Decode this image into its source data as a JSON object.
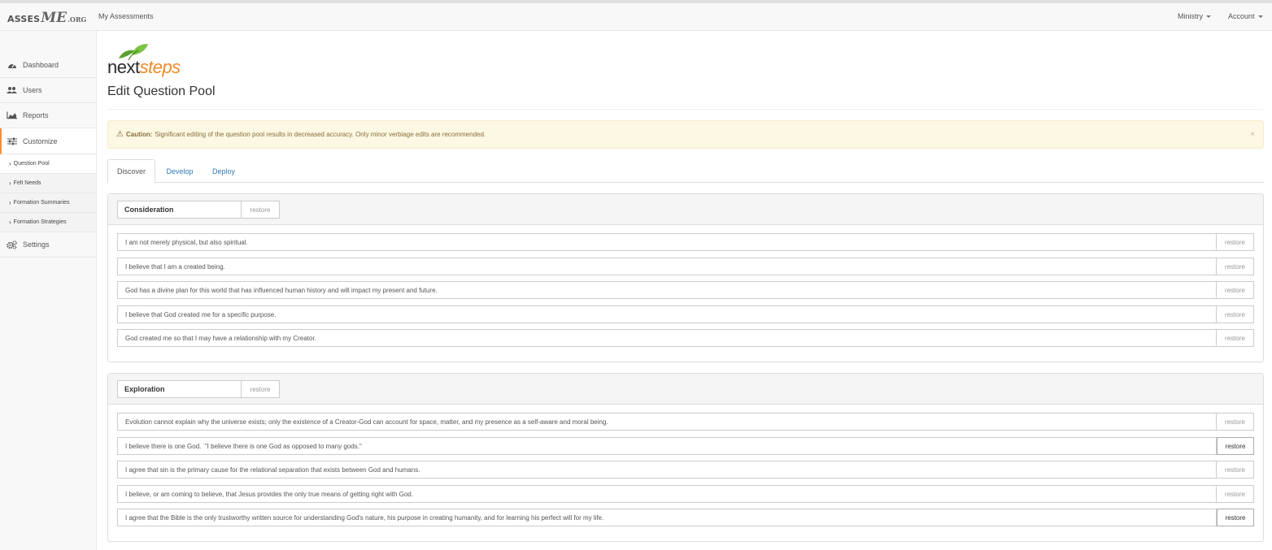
{
  "brand": {
    "part1": "ASSES",
    "part2": "ME",
    "part3": ".ORG"
  },
  "nav": {
    "my_assessments": "My Assessments",
    "ministry": "Ministry",
    "account": "Account"
  },
  "sidebar": {
    "items": [
      {
        "label": "Dashboard",
        "icon": "dashboard-icon"
      },
      {
        "label": "Users",
        "icon": "users-icon"
      },
      {
        "label": "Reports",
        "icon": "area-chart-icon"
      },
      {
        "label": "Customize",
        "icon": "sliders-icon"
      }
    ],
    "subitems": [
      {
        "label": "Question Pool"
      },
      {
        "label": "Felt Needs"
      },
      {
        "label": "Formation Summaries"
      },
      {
        "label": "Formation Strategies"
      }
    ],
    "settings": {
      "label": "Settings",
      "icon": "gears-icon"
    }
  },
  "logo": {
    "part1": "next",
    "part2": "steps"
  },
  "page": {
    "title": "Edit Question Pool"
  },
  "alert": {
    "strong": "Caution:",
    "text": "Significant editing of the question pool results in decreased accuracy. Only minor verbiage edits are recommended.",
    "close": "×"
  },
  "tabs": [
    {
      "label": "Discover"
    },
    {
      "label": "Develop"
    },
    {
      "label": "Deploy"
    }
  ],
  "groups": [
    {
      "name": "Consideration",
      "restore_label": "restore",
      "questions": [
        {
          "text": "I am not merely physical, but also spiritual.",
          "restore": "restore"
        },
        {
          "text": "I believe that I am a created being.",
          "restore": "restore"
        },
        {
          "text": "God has a divine plan for this world that has influenced human history and will impact my present and future.",
          "restore": "restore"
        },
        {
          "text": "I believe that God created me for a specific purpose.",
          "restore": "restore"
        },
        {
          "text": "God created me so that I may have a relationship with my Creator.",
          "restore": "restore"
        }
      ]
    },
    {
      "name": "Exploration",
      "restore_label": "restore",
      "questions": [
        {
          "text": "Evolution cannot explain why the universe exists; only the existence of a Creator-God can account for space, matter, and my presence as a self-aware and moral being.",
          "restore": "restore"
        },
        {
          "text": "I believe there is one God.  \"I believe there is one God as opposed to many gods.\"",
          "restore": "restore"
        },
        {
          "text": "I agree that sin is the primary cause for the relational separation that exists between God and humans.",
          "restore": "restore"
        },
        {
          "text": "I believe, or am coming to believe, that Jesus provides the only true means of getting right with God.",
          "restore": "restore"
        },
        {
          "text": "I agree that the Bible is the only trustworthy written source for understanding God's nature, his purpose in creating humanity, and for learning his perfect will for my life.",
          "restore": "restore"
        }
      ]
    }
  ],
  "colors": {
    "accent": "#ff8c2b",
    "link": "#337ab7",
    "alert_bg": "#fcf8e3",
    "alert_text": "#8a6d3b",
    "logo_orange": "#f08a2a",
    "logo_green": "#5aa02c"
  }
}
